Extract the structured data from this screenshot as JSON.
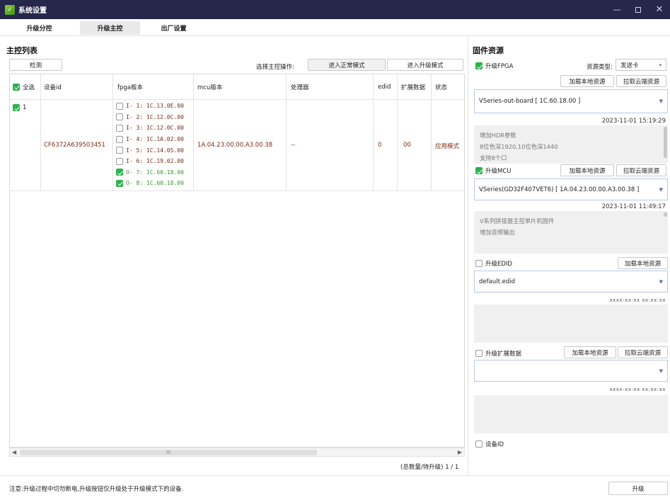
{
  "window": {
    "title": "系统设置",
    "min_icon": "minimize-icon",
    "max_icon": "maximize-icon",
    "close_icon": "close-icon"
  },
  "tabs": [
    {
      "label": "升级分控",
      "active": false
    },
    {
      "label": "升级主控",
      "active": true
    },
    {
      "label": "出厂设置",
      "active": false
    }
  ],
  "left": {
    "title": "主控列表",
    "detect_button": "检测",
    "select_op_label": "选择主控操作:",
    "normal_mode_button": "进入正常模式",
    "upgrade_mode_button": "进入升级模式",
    "table": {
      "headers": {
        "select_all": "全选",
        "device_id": "设备id",
        "fpga": "fpga板本",
        "mcu": "mcu版本",
        "processor": "处理器",
        "edid": "edid",
        "ext": "扩展数据",
        "status": "状态"
      },
      "row": {
        "index": "1",
        "checked": true,
        "device_id": "CF6372A639503451",
        "fpga_items": [
          {
            "text": "I- 1: 1C.13.0E.00",
            "checked": false
          },
          {
            "text": "I- 2: 1C.12.0C.00",
            "checked": false
          },
          {
            "text": "I- 3: 1C.12.0C.00",
            "checked": false
          },
          {
            "text": "I- 4: 1C.1A.02.00",
            "checked": false
          },
          {
            "text": "I- 5: 1C.14.05.00",
            "checked": false
          },
          {
            "text": "I- 6: 1C.19.02.00",
            "checked": false
          },
          {
            "text": "O- 7: 1C.60.18.00",
            "checked": true
          },
          {
            "text": "O- 8: 1C.60.18.00",
            "checked": true
          }
        ],
        "mcu": "1A.04.23.00.00.A3.00.38",
        "processor": "--",
        "edid": "0",
        "ext": "00",
        "status": "应用模式"
      }
    },
    "scroll_thumb_text": "III",
    "pagination": "(总数量/待升级) 1 / 1"
  },
  "right": {
    "title": "固件资源",
    "fpga": {
      "label": "升级FPGA",
      "checked": true,
      "resource_type_label": "资源类型:",
      "resource_type_value": "发送卡",
      "load_local": "加载本地资源",
      "pull_cloud": "拉取云端资源",
      "selected": "VSeries-out-board [ 1C.60.18.00 ]",
      "timestamp": "2023-11-01 15:19:29",
      "notes": [
        "增加HDR参数",
        "8位色深1920,10位色深1440",
        "支持8个口"
      ]
    },
    "mcu": {
      "label": "升级MCU",
      "checked": true,
      "load_local": "加载本地资源",
      "pull_cloud": "拉取云端资源",
      "selected": "VSeries(GD32F407VET6) [ 1A.04.23.00.00.A3.00.38 ]",
      "timestamp": "2023-11-01 11:49:17",
      "notes": [
        "V系列拼接器主控单片机固件",
        "增加音频输出"
      ]
    },
    "edid": {
      "label": "升级EDID",
      "checked": false,
      "load_local": "加载本地资源",
      "selected": "default.edid",
      "timestamp": "xxxx-xx-xx xx:xx:xx"
    },
    "ext": {
      "label": "升级扩展数据",
      "checked": false,
      "load_local": "加载本地资源",
      "pull_cloud": "拉取云端资源",
      "selected": "",
      "timestamp": "xxxx-xx-xx xx:xx:xx"
    },
    "device_id": {
      "label": "设备ID",
      "checked": false
    }
  },
  "footer": {
    "note": "注意:升级过程中切勿断电,升级按钮仅升级处于升级模式下的设备.",
    "upgrade_button": "升级"
  }
}
